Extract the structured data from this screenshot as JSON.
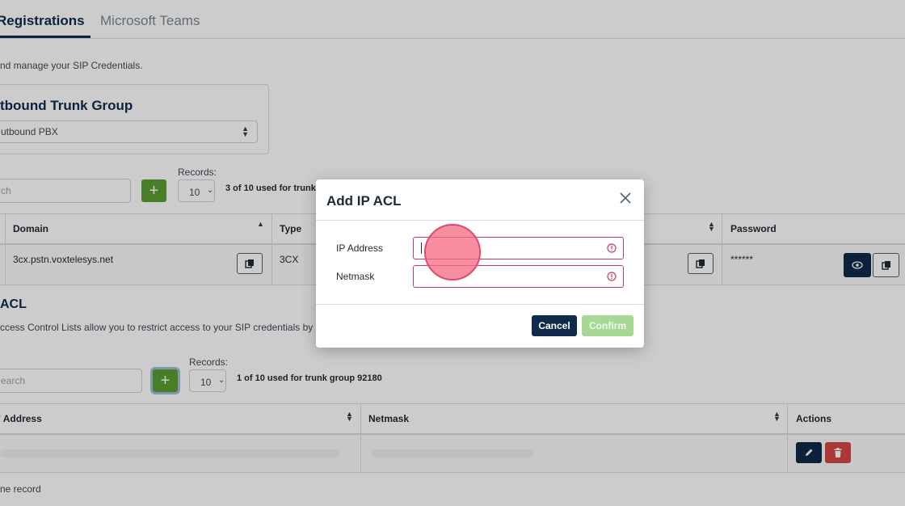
{
  "tabs": [
    {
      "label": "Registrations",
      "active": true
    },
    {
      "label": "Microsoft Teams",
      "active": false
    }
  ],
  "intro_text": "nd manage your SIP Credentials.",
  "trunk_group": {
    "title": "tbound Trunk Group",
    "selected": "utbound PBX"
  },
  "credentials": {
    "search_placeholder": "ch",
    "records_label": "Records:",
    "records_value": "10",
    "usage_text": "3 of 10 used for trunk",
    "columns": {
      "domain": "Domain",
      "type": "Type",
      "password": "Password"
    },
    "row": {
      "domain": "3cx.pstn.voxtelesys.net",
      "type": "3CX",
      "password": "******"
    }
  },
  "acl": {
    "title": "ACL",
    "description": "ccess Control Lists allow you to restrict access to your SIP credentials by IP a",
    "search_placeholder": "earch",
    "records_label": "Records:",
    "records_value": "10",
    "usage_text": "1 of 10 used for trunk group 92180",
    "columns": {
      "ip": "' Address",
      "netmask": "Netmask",
      "actions": "Actions"
    },
    "footer": "ne record"
  },
  "modal": {
    "title": "Add IP ACL",
    "ip_label": "IP Address",
    "netmask_label": "Netmask",
    "ip_value": "",
    "netmask_value": "",
    "cancel_label": "Cancel",
    "confirm_label": "Confirm"
  },
  "colors": {
    "brand_navy": "#102a4c",
    "add_green": "#5a9e33",
    "error_red": "#c53d5c",
    "confirm_disabled": "#a8d896",
    "delete_red": "#d64545"
  },
  "icons": {
    "copy": "copy-icon",
    "eye": "eye-icon",
    "edit": "pencil-icon",
    "delete": "trash-icon",
    "close": "close-icon",
    "alert": "alert-circle-icon"
  }
}
